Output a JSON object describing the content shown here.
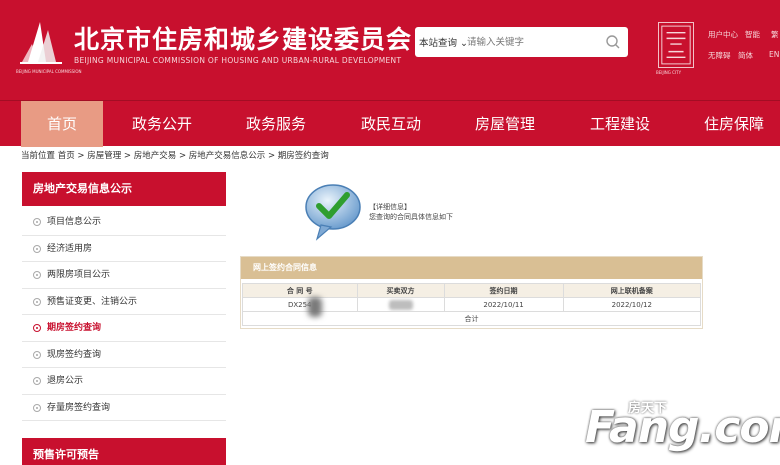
{
  "header": {
    "title": "北京市住房和城乡建设委员会",
    "subtitle": "BEIJING MUNICIPAL COMMISSION OF HOUSING AND URBAN-RURAL DEVELOPMENT",
    "logo_caption": "BEIJING MUNICIPAL COMMISSION",
    "brand_color": "#c8102e",
    "search": {
      "scope": "本站查询",
      "placeholder": "请输入关键字"
    },
    "seal_caption": "BEIJING CITY",
    "links": [
      "用户中心",
      "智能",
      "无障碍",
      "繁",
      "简体",
      "EN"
    ]
  },
  "nav": {
    "items": [
      "首页",
      "政务公开",
      "政务服务",
      "政民互动",
      "房屋管理",
      "工程建设",
      "住房保障"
    ],
    "active_index": 0
  },
  "breadcrumb": "当前位置  首页 > 房屋管理 > 房地产交易 > 房地产交易信息公示 > 期房签约查询",
  "sidebar": {
    "section1_title": "房地产交易信息公示",
    "items": [
      "项目信息公示",
      "经济适用房",
      "两限房项目公示",
      "预售证变更、注销公示",
      "期房签约查询",
      "现房签约查询",
      "退房公示",
      "存量房签约查询"
    ],
    "active_index": 4,
    "section2_title": "预售许可预告"
  },
  "result": {
    "info_title": "【详细信息】",
    "info_text": "您查询的合同具体信息如下",
    "panel_title": "网上签约合同信息",
    "columns": [
      "合 同 号",
      "买卖双方",
      "签约日期",
      "网上联机备案"
    ],
    "row": {
      "contract_no": "DX254",
      "sign_date": "2022/10/11",
      "record_date": "2022/10/12"
    },
    "total_label": "合计"
  },
  "watermark": {
    "text": "Fang.com",
    "cn": "房天下"
  }
}
